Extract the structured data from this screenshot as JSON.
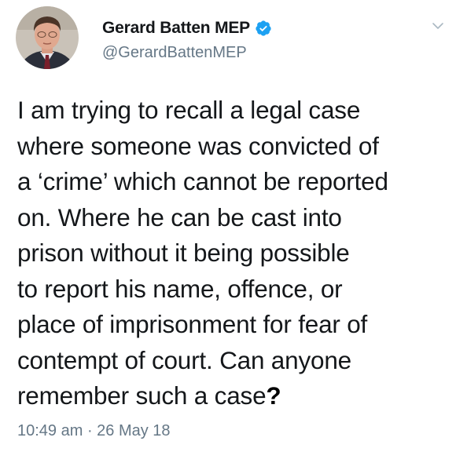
{
  "tweet": {
    "author": {
      "display_name": "Gerard Batten MEP",
      "handle": "@GerardBattenMEP",
      "verified": true
    },
    "text_main": "I am trying to recall a legal case\nwhere someone was convicted of\na ‘crime’ which cannot be reported\non. Where he can be cast into\nprison without it being possible\nto report his name, offence, or\nplace of imprisonment for fear of\ncontempt of court. Can anyone\nremember such a case",
    "text_end": "?",
    "timestamp": "10:49 am · 26 May 18"
  },
  "icons": {
    "verified": "verified-badge-icon",
    "menu": "chevron-down-icon"
  },
  "colors": {
    "text": "#14171a",
    "secondary": "#657786",
    "verified_blue": "#1da1f2"
  }
}
